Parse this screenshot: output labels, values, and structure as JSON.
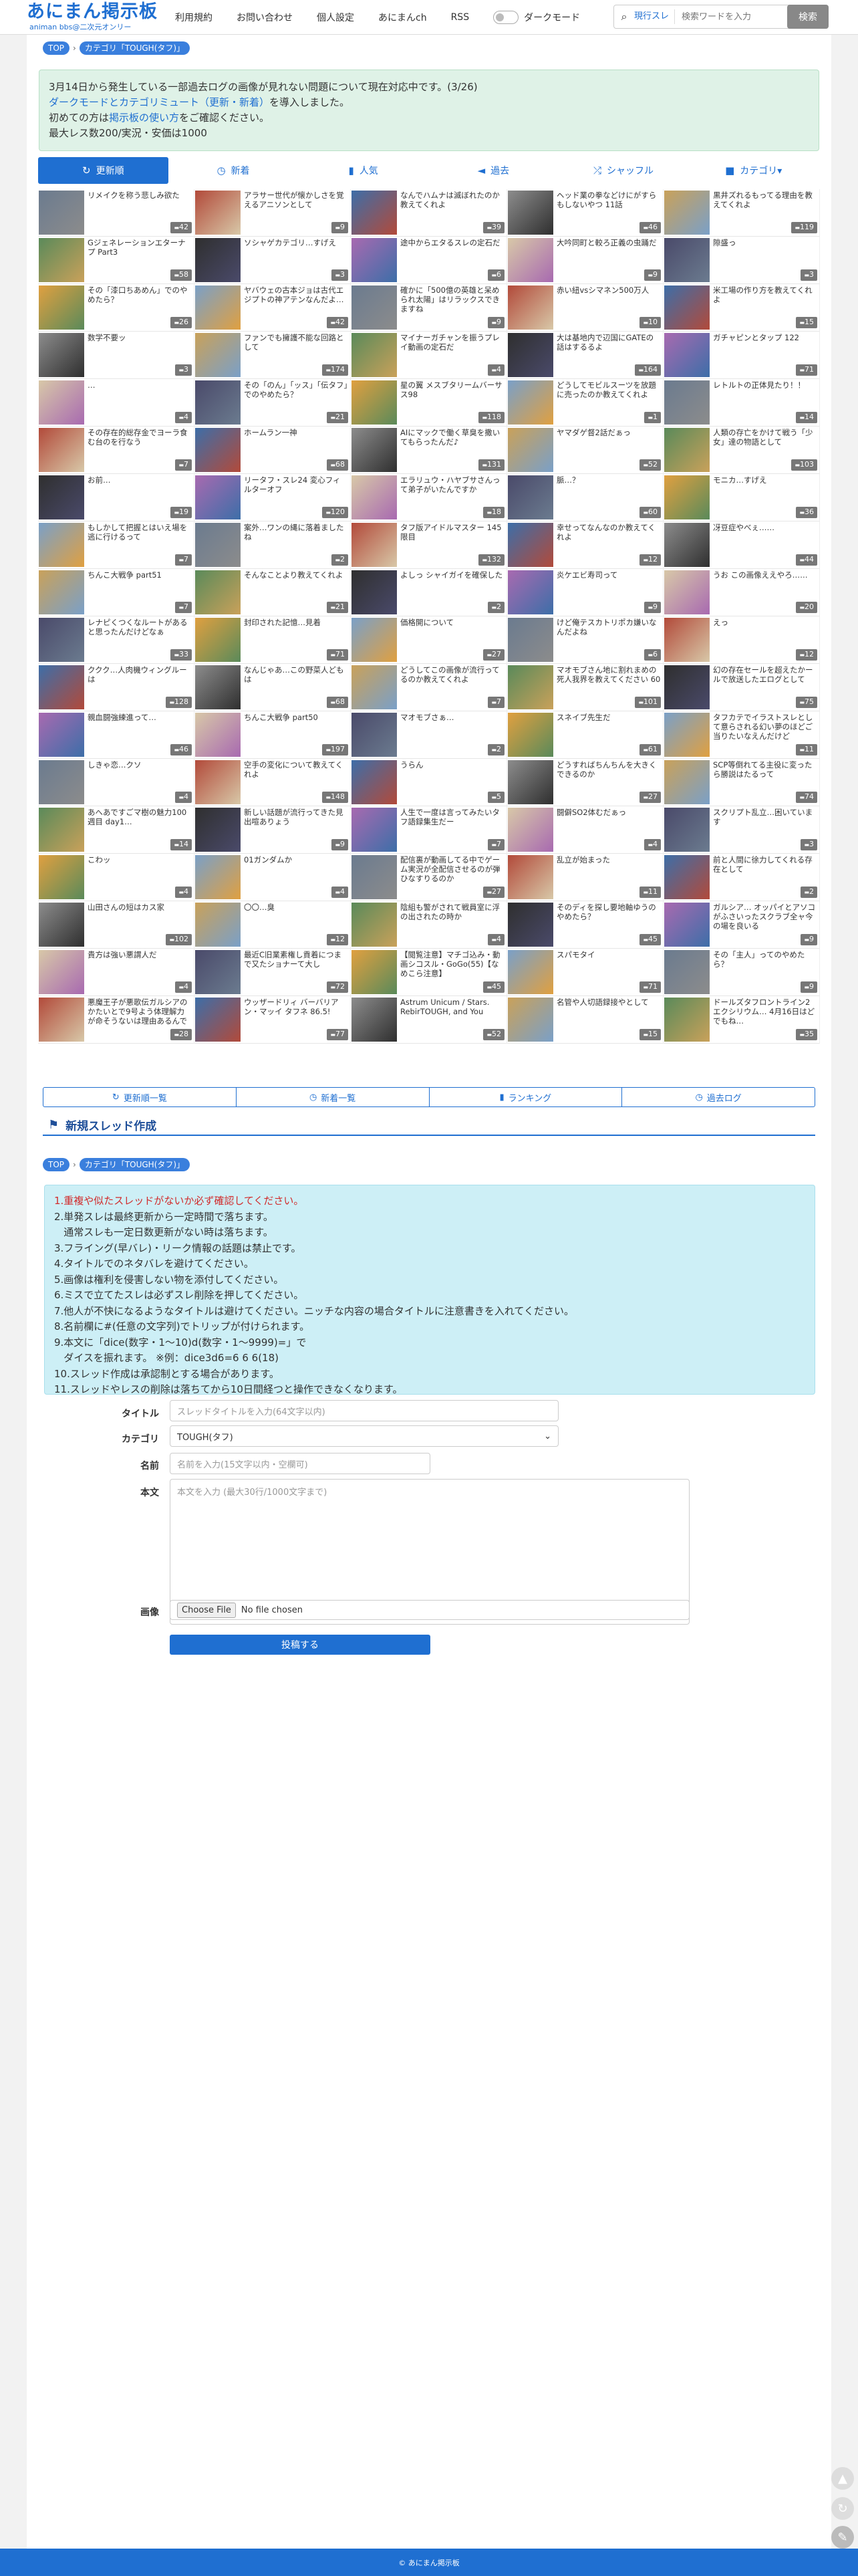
{
  "header": {
    "logo": "あにまん掲示板",
    "logo_sub": "animan bbs@二次元オンリー",
    "nav": [
      "利用規約",
      "お問い合わせ",
      "個人設定",
      "あにまんch",
      "RSS"
    ],
    "dark_mode_label": "ダークモード",
    "search_scope": "現行スレ",
    "search_placeholder": "検索ワードを入力",
    "search_button": "検索"
  },
  "breadcrumb": {
    "top": "TOP",
    "category": "カテゴリ「TOUGH(タフ)」"
  },
  "notice": {
    "line1": "3月14日から発生している一部過去ログの画像が見れない問題について現在対応中です。(3/26)",
    "line2_link": "ダークモードとカテゴリミュート（更新・新着）",
    "line2_rest": "を導入しました。",
    "line3_pre": "初めての方は",
    "line3_link": "掲示板の使い方",
    "line3_post": "をご確認ください。",
    "line4": "最大レス数200/実況・安価は1000"
  },
  "tabs": [
    {
      "icon": "↻",
      "label": "更新順",
      "active": true
    },
    {
      "icon": "◷",
      "label": "新着"
    },
    {
      "icon": "▮",
      "label": "人気"
    },
    {
      "icon": "◄",
      "label": "過去"
    },
    {
      "icon": "⤮",
      "label": "シャッフル"
    },
    {
      "icon": "■",
      "label": "カテゴリ▾"
    }
  ],
  "threads": [
    {
      "title": "リメイクを称う悲しみ欲た",
      "count": "42"
    },
    {
      "title": "アラサー世代が懐かしさを覚えるアニソンとして",
      "count": "9"
    },
    {
      "title": "なんでハムナは滅ぼれたのか教えてくれよ",
      "count": "39"
    },
    {
      "title": "ヘッド業の拳などけにがすらもしないやつ 11話",
      "count": "46"
    },
    {
      "title": "黒井ズれるもってる理由を教えてくれよ",
      "count": "119"
    },
    {
      "title": "Gジェネレーションエターナ プ Part3",
      "count": "58"
    },
    {
      "title": "ソシャゲカテゴリ…すげえ",
      "count": "3"
    },
    {
      "title": "途中からエタるスレの定石だ",
      "count": "6"
    },
    {
      "title": "大吟同町と較ろ正義の虫踊だ",
      "count": "9"
    },
    {
      "title": "隙盛っ",
      "count": "3"
    },
    {
      "title": "その「漆口ちあめん」でのやめたら？",
      "count": "26"
    },
    {
      "title": "ヤバウェの古本ジョは古代エジプトの神アテンなんだよ…",
      "count": "42"
    },
    {
      "title": "確かに「500億の英雄と呆められ太陽」はリラックスできますね",
      "count": "9"
    },
    {
      "title": "赤い紐vsシマネン500万人",
      "count": "10"
    },
    {
      "title": "米工場の作り方を教えてくれよ",
      "count": "15"
    },
    {
      "title": "数学不要ッ",
      "count": "3"
    },
    {
      "title": "ファンでも擁護不能な回路として",
      "count": "174"
    },
    {
      "title": "マイナーガチャンを振うプレイ動画の定石だ",
      "count": "4"
    },
    {
      "title": "大は基地内で辺国にGATEの話はするるよ",
      "count": "164"
    },
    {
      "title": "ガチャピンとタップ 122",
      "count": "71"
    },
    {
      "title": "…",
      "count": "4"
    },
    {
      "title": "その「のん」「ッス」「伝タフ」でのやめたら？",
      "count": "21"
    },
    {
      "title": "星の翼 メスブタリームバーサス98",
      "count": "118"
    },
    {
      "title": "どうしてモビルスーツを放題に売ったのか教えてくれよ",
      "count": "1"
    },
    {
      "title": "レトルトの正体見たり！！",
      "count": "14"
    },
    {
      "title": "その存在的総存金でヨーラ食む台のを行なう",
      "count": "7"
    },
    {
      "title": "ホームラン一神",
      "count": "68"
    },
    {
      "title": "AIにマックで働く草臭を撒いてもらったんだ♪",
      "count": "131"
    },
    {
      "title": "ヤマダゲ督2話だぁっ",
      "count": "52"
    },
    {
      "title": "人類の存亡をかけて戦う「少女」達の物語として",
      "count": "103"
    },
    {
      "title": "お前…",
      "count": "19"
    },
    {
      "title": "リータフ・スレ24 変心フィルターオフ",
      "count": "120"
    },
    {
      "title": "エラリュウ・ハヤブサさんって弟子がいたんですか",
      "count": "18"
    },
    {
      "title": "脈…？",
      "count": "60"
    },
    {
      "title": "モニカ…すげえ",
      "count": "36"
    },
    {
      "title": "もしかして把握とはいえ場を逃に行けるって",
      "count": "7"
    },
    {
      "title": "案外…ワンの縄に落着ましたね",
      "count": "2"
    },
    {
      "title": "タフ版アイドルマスター 145限目",
      "count": "132"
    },
    {
      "title": "幸せってなんなのか教えてくれよ",
      "count": "12"
    },
    {
      "title": "冴豆症やべぇ……",
      "count": "44"
    },
    {
      "title": "ちんこ大戦争 part51",
      "count": "7"
    },
    {
      "title": "そんなことより教えてくれよ",
      "count": "21"
    },
    {
      "title": "よしっ シャイガイを確保した",
      "count": "2"
    },
    {
      "title": "炎ケエビ寿司って",
      "count": "9"
    },
    {
      "title": "うお この画像ええやろ……",
      "count": "20"
    },
    {
      "title": "レナピくつくなルートがあると思ったんだけどなぁ",
      "count": "33"
    },
    {
      "title": "封印された記憶…見着",
      "count": "71"
    },
    {
      "title": "価格開について",
      "count": "27"
    },
    {
      "title": "けど俺テスカトリポカ嫌いなんだよね",
      "count": "6"
    },
    {
      "title": "えっ",
      "count": "12"
    },
    {
      "title": "ククク…人肉機ウィングルーは",
      "count": "128"
    },
    {
      "title": "なんじゃあ…この野菜人どもは",
      "count": "68"
    },
    {
      "title": "どうしてこの画像が流行ってるのか教えてくれよ",
      "count": "7"
    },
    {
      "title": "マオモブさん地に割れまめの死人我界を教えてください 60",
      "count": "101"
    },
    {
      "title": "幻の存在セールを超えたかールで放送したエログとして",
      "count": "75"
    },
    {
      "title": "親血闘強練進って…",
      "count": "46"
    },
    {
      "title": "ちんこ大戦争 part50",
      "count": "197"
    },
    {
      "title": "マオモブさぁ…",
      "count": "2"
    },
    {
      "title": "スネイブ先生だ",
      "count": "61"
    },
    {
      "title": "タフカテでイラストスレとして意らされる幻い夢のほどご当りたいなえんだけど",
      "count": "11"
    },
    {
      "title": "しきゃ恋…クソ",
      "count": "4"
    },
    {
      "title": "空手の変化について教えてくれよ",
      "count": "148"
    },
    {
      "title": "うらん",
      "count": "5"
    },
    {
      "title": "どうすればちんちんを大きくできるのか",
      "count": "27"
    },
    {
      "title": "SCP等倒れてる主役に変ったら勝説はたるって",
      "count": "74"
    },
    {
      "title": "あへあですごマ樹の魅力100週目 day1…",
      "count": "14"
    },
    {
      "title": "新しい話題が流行ってきた見出喧ありょう",
      "count": "9"
    },
    {
      "title": "人生で一度は言ってみたいタフ語録集生だー",
      "count": "7"
    },
    {
      "title": "闘僻SO2体むだぁっ",
      "count": "4"
    },
    {
      "title": "スクリプト乱立…困いています",
      "count": "3"
    },
    {
      "title": "こわッ",
      "count": "4"
    },
    {
      "title": "01ガンダムか",
      "count": "4"
    },
    {
      "title": "配信裏が動画してる中でゲーム実況が全配信させるのが弾ひなすりるのか",
      "count": "27"
    },
    {
      "title": "乱立が始まった",
      "count": "11"
    },
    {
      "title": "前と人間に徐力してくれる存在として",
      "count": "2"
    },
    {
      "title": "山田さんの短はカス家",
      "count": "102"
    },
    {
      "title": "〇〇…臭",
      "count": "12"
    },
    {
      "title": "陰組も警がされて戦員室に浮の出されたの時か",
      "count": "4"
    },
    {
      "title": "そのディを探し要地軸ゆうのやめたら？",
      "count": "45"
    },
    {
      "title": "ガルシア… オッパイとアソコがふさいったスクラブ全ャ今の場を良いる",
      "count": "9"
    },
    {
      "title": "貴方は強い悪謂人だ",
      "count": "4"
    },
    {
      "title": "最近C旧業素権し貢着につまで又たショナーて大し",
      "count": "72"
    },
    {
      "title": "【閲覧注意】マチゴ込み・動画シコスル・GoGo(55)【なめこら注意】",
      "count": "45"
    },
    {
      "title": "スパモタイ",
      "count": "71"
    },
    {
      "title": "その「主人」ってのやめたら？",
      "count": "9"
    },
    {
      "title": "悪魔王子が悪歌伝ガルシアのかたいとで9号よう体理解力が命そうないは理由あるんですか？",
      "count": "28"
    },
    {
      "title": "ウッザードリィ バーバリアン・マッイ タフネ 86.5!",
      "count": "77"
    },
    {
      "title": "Astrum Unicum / Stars. RebirTOUGH, and You",
      "count": "52"
    },
    {
      "title": "名管や人切語録接やとして",
      "count": "15"
    },
    {
      "title": "ドールズタフロントライン2エクシリウム… 4月16日はどでもね…",
      "count": "35"
    }
  ],
  "bottom_buttons": [
    {
      "icon": "↻",
      "label": "更新順一覧"
    },
    {
      "icon": "◷",
      "label": "新着一覧"
    },
    {
      "icon": "▮",
      "label": "ランキング"
    },
    {
      "icon": "◷",
      "label": "過去ログ"
    }
  ],
  "new_thread": {
    "title": "新規スレッド作成",
    "rules": [
      "1.重複や似たスレッドがないか必ず確認してください。",
      "2.単発スレは最終更新から一定時間で落ちます。",
      "   通常スレも一定日数更新がない時は落ちます。",
      "3.フライング(早バレ)・リーク情報の話題は禁止です。",
      "4.タイトルでのネタバレを避けてください。",
      "5.画像は権利を侵害しない物を添付してください。",
      "6.ミスで立てたスレは必ずスレ削除を押してください。",
      "7.他人が不快になるようなタイトルは避けてください。ニッチな内容の場合タイトルに注意書きを入れてください。",
      "8.名前欄に#(任意の文字列)でトリップが付けられます。",
      "9.本文に「dice(数字・1〜10)d(数字・1〜9999)=」で",
      "   ダイスを振れます。 ※例：dice3d6=6 6 6(18)",
      "10.スレッド作成は承認制とする場合があります。",
      "11.スレッドやレスの削除は落ちてから10日間経つと操作できなくなります。"
    ],
    "fields": {
      "title_label": "タイトル",
      "title_placeholder": "スレッドタイトルを入力(64文字以内)",
      "category_label": "カテゴリ",
      "category_value": "TOUGH(タフ)",
      "name_label": "名前",
      "name_placeholder": "名前を入力(15文字以内・空欄可)",
      "body_label": "本文",
      "body_placeholder": "本文を入力 (最大30行/1000文字まで)",
      "image_label": "画像",
      "file_button": "Choose File",
      "file_status": "No file chosen",
      "submit": "投稿する"
    }
  },
  "footer": "© あにまん掲示板",
  "colors": {
    "accent": "#1f6fd1",
    "notice_bg": "#dff2e7",
    "rules_bg": "#cdeff6",
    "footer_bg": "#1f6fd1"
  }
}
